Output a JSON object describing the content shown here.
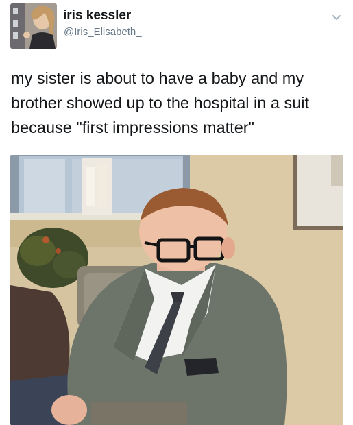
{
  "tweet": {
    "display_name": "iris kessler",
    "handle": "@Iris_Elisabeth_",
    "text": "my sister is about to have a baby and my\nbrother showed up to the hospital in a suit\nbecause \"first impressions matter\"",
    "menu_icon": "chevron-down-icon",
    "avatar_icon": "profile-photo",
    "media_icon": "photo"
  },
  "colors": {
    "name": "#14171a",
    "handle": "#657786",
    "wall": "#d8c7a4",
    "suit": "#6d7469"
  }
}
